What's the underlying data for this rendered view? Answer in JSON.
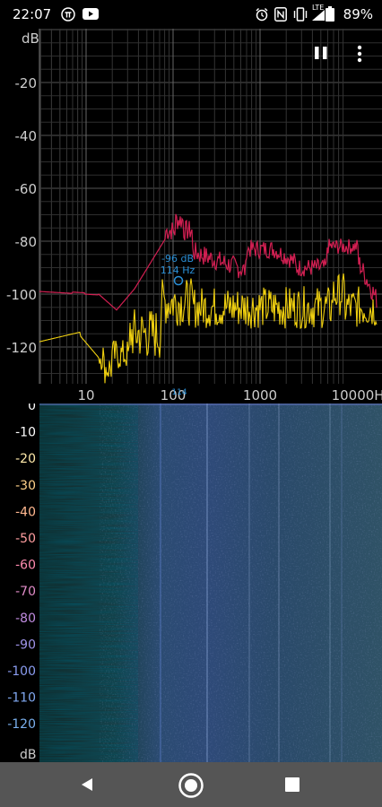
{
  "status_bar": {
    "time": "22:07",
    "left_icons": [
      "pi-icon",
      "youtube-icon"
    ],
    "right_icons": [
      "alarm-icon",
      "nfc-icon",
      "vibrate-icon",
      "lte-signal-icon",
      "battery-icon"
    ],
    "network": "LTE",
    "battery": "89%"
  },
  "spectrum": {
    "y_unit": "dB",
    "y_ticks": [
      "-20",
      "-40",
      "-60",
      "-80",
      "-100",
      "-120"
    ],
    "x_ticks": [
      "10",
      "100",
      "1000",
      "10000Hz"
    ],
    "marker": {
      "db_label": "-96 dB",
      "freq_label": "114 Hz"
    },
    "peak_hold_color": "#d21f52",
    "live_color": "#f0d010",
    "marker_color": "#2a8fd6"
  },
  "spectrogram": {
    "y_ticks": [
      "0",
      "-10",
      "-20",
      "-30",
      "-40",
      "-50",
      "-60",
      "-70",
      "-80",
      "-90",
      "-100",
      "-110",
      "-120"
    ],
    "y_unit": "dB"
  },
  "toolbar": {
    "pause_icon": "pause-icon",
    "menu_icon": "more-vert-icon"
  },
  "nav": {
    "icons": [
      "back-icon",
      "home-icon",
      "recents-icon"
    ]
  }
}
